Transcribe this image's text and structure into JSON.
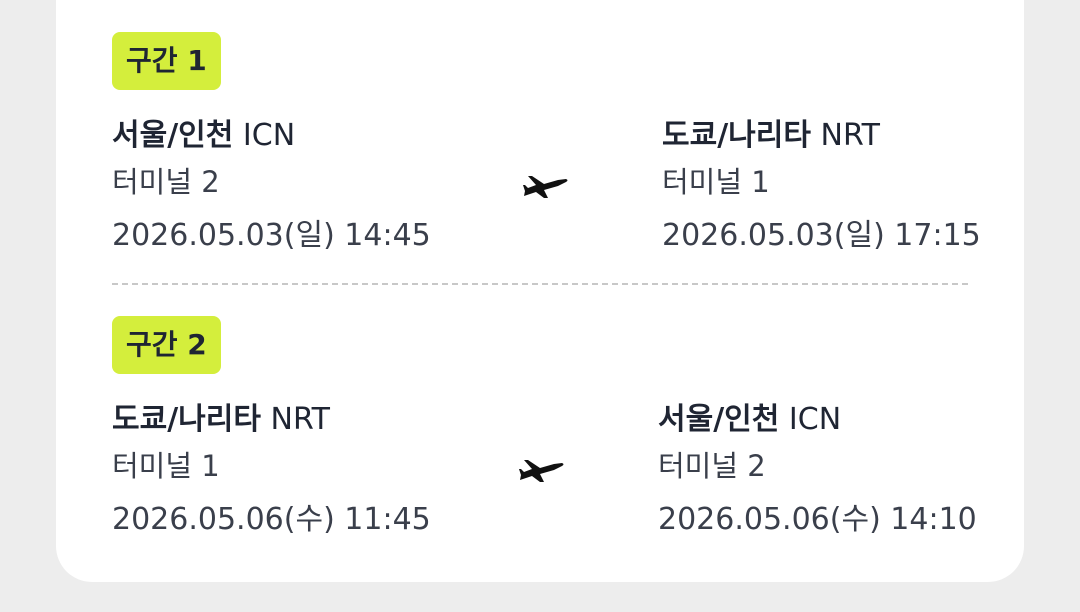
{
  "segments": [
    {
      "label": "구간 1",
      "departure": {
        "city": "서울/인천",
        "code": "ICN",
        "terminal": "터미널 2",
        "datetime": "2026.05.03(일) 14:45"
      },
      "arrival": {
        "city": "도쿄/나리타",
        "code": "NRT",
        "terminal": "터미널 1",
        "datetime": "2026.05.03(일) 17:15"
      }
    },
    {
      "label": "구간 2",
      "departure": {
        "city": "도쿄/나리타",
        "code": "NRT",
        "terminal": "터미널 1",
        "datetime": "2026.05.06(수) 11:45"
      },
      "arrival": {
        "city": "서울/인천",
        "code": "ICN",
        "terminal": "터미널 2",
        "datetime": "2026.05.06(수) 14:10"
      }
    }
  ],
  "icons": {
    "route": "airplane-icon"
  },
  "colors": {
    "badge_bg": "#d4ee3c",
    "text": "#1f2533"
  }
}
